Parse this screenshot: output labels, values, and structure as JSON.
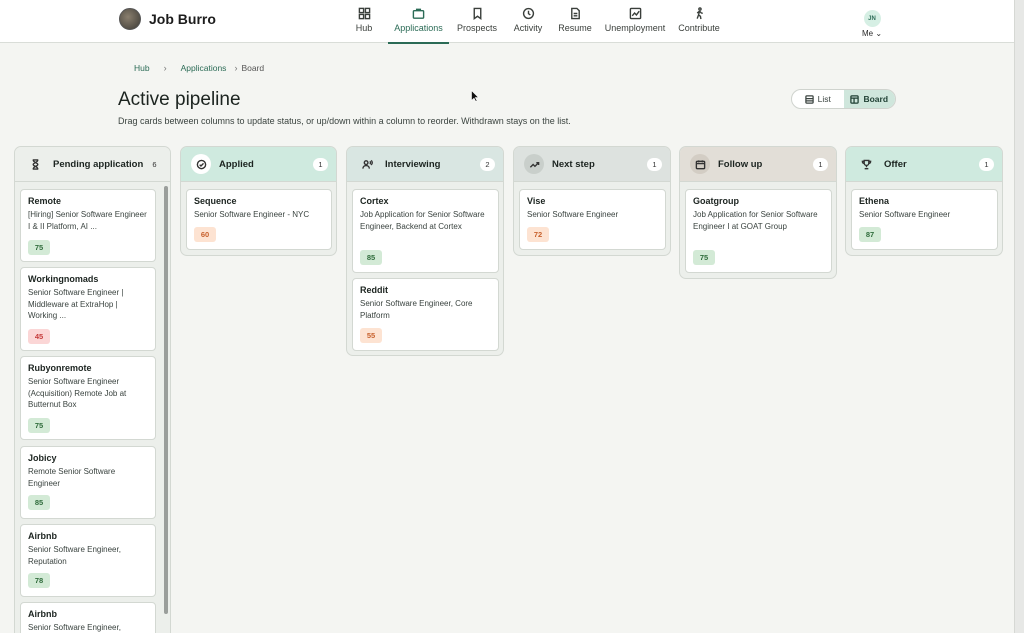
{
  "app": {
    "name": "Job Burro"
  },
  "nav": [
    {
      "label": "Hub",
      "icon": "grid-icon"
    },
    {
      "label": "Applications",
      "icon": "briefcase-icon",
      "active": true
    },
    {
      "label": "Prospects",
      "icon": "bookmark-icon"
    },
    {
      "label": "Activity",
      "icon": "history-icon"
    },
    {
      "label": "Resume",
      "icon": "document-icon"
    },
    {
      "label": "Unemployment",
      "icon": "chart-icon"
    },
    {
      "label": "Contribute",
      "icon": "walking-icon"
    }
  ],
  "user": {
    "initials": "JN",
    "menu_label": "Me ⌄"
  },
  "breadcrumb": {
    "hub": "Hub",
    "applications": "Applications",
    "current": "Board",
    "sep": "›"
  },
  "page": {
    "title": "Active pipeline",
    "description": "Drag cards between columns to update status, or up/down within a column to reorder. Withdrawn stays on the list."
  },
  "view_toggle": {
    "list": "List",
    "board": "Board",
    "active": "board"
  },
  "colors": {
    "accent": "#2b6b56",
    "header_pending": "#ecefeb",
    "header_applied": "#cfeadf",
    "header_interviewing": "#d9e6e2",
    "header_next": "#dde2df",
    "header_followup": "#e2ded7",
    "header_offer": "#cfeadf",
    "score_good": "#d3ead6",
    "score_mid": "#fde3d2",
    "score_low": "#fbd6d6"
  },
  "columns": [
    {
      "title": "Pending application",
      "count": "6",
      "icon": "hourglass-icon",
      "cards": [
        {
          "company": "Remote",
          "title": "[Hiring] Senior Software Engineer I & II Platform, AI ...",
          "score": "75",
          "level": "good"
        },
        {
          "company": "Workingnomads",
          "title": "Senior Software Engineer | Middleware at ExtraHop | Working ...",
          "score": "45",
          "level": "low"
        },
        {
          "company": "Rubyonremote",
          "title": "Senior Software Engineer (Acquisition) Remote Job at Butternut Box",
          "score": "75",
          "level": "good"
        },
        {
          "company": "Jobicy",
          "title": "Remote Senior Software Engineer",
          "score": "85",
          "level": "good"
        },
        {
          "company": "Airbnb",
          "title": "Senior Software Engineer, Reputation",
          "score": "78",
          "level": "good"
        },
        {
          "company": "Airbnb",
          "title": "Senior Software Engineer,",
          "score": "",
          "level": "good"
        }
      ]
    },
    {
      "title": "Applied",
      "count": "1",
      "icon": "check-circle-icon",
      "cards": [
        {
          "company": "Sequence",
          "title": "Senior Software Engineer - NYC",
          "score": "60",
          "level": "mid"
        }
      ]
    },
    {
      "title": "Interviewing",
      "count": "2",
      "icon": "people-icon",
      "cards": [
        {
          "company": "Cortex",
          "title": "Job Application for Senior Software Engineer, Backend at Cortex",
          "score": "85",
          "level": "good"
        },
        {
          "company": "Reddit",
          "title": "Senior Software Engineer, Core Platform",
          "score": "55",
          "level": "mid"
        }
      ]
    },
    {
      "title": "Next step",
      "count": "1",
      "icon": "trending-icon",
      "cards": [
        {
          "company": "Vise",
          "title": "Senior Software Engineer",
          "score": "72",
          "level": "mid"
        }
      ]
    },
    {
      "title": "Follow up",
      "count": "1",
      "icon": "calendar-icon",
      "cards": [
        {
          "company": "Goatgroup",
          "title": "Job Application for Senior Software Engineer I at GOAT Group",
          "score": "75",
          "level": "good"
        }
      ]
    },
    {
      "title": "Offer",
      "count": "1",
      "icon": "trophy-icon",
      "cards": [
        {
          "company": "Ethena",
          "title": "Senior Software Engineer",
          "score": "87",
          "level": "good"
        }
      ]
    }
  ]
}
